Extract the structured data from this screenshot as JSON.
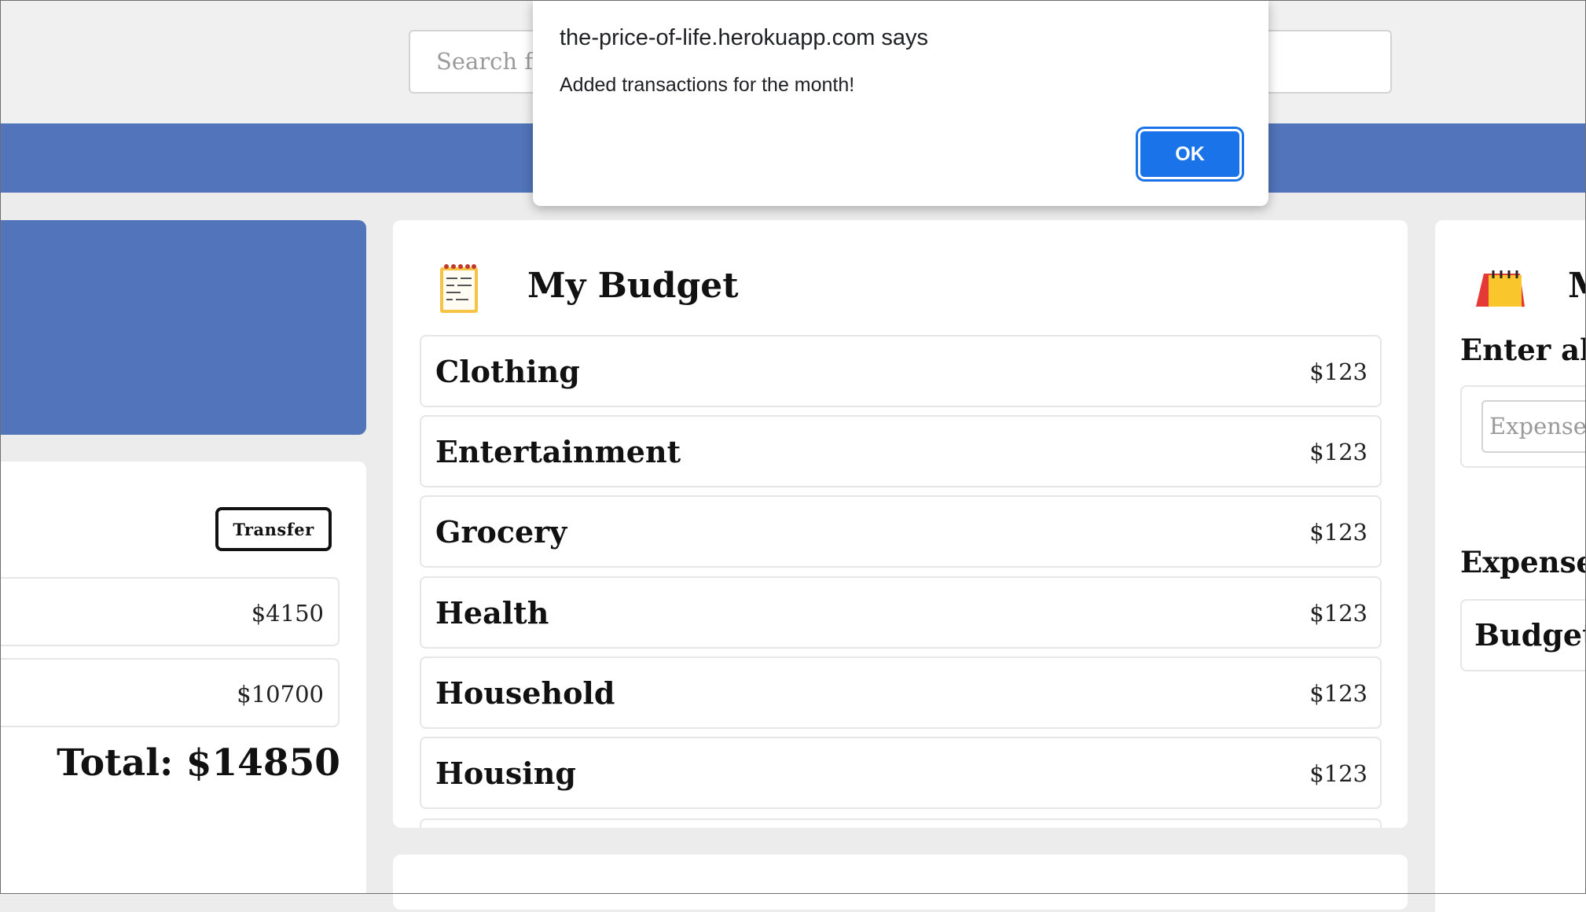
{
  "search": {
    "placeholder": "Search for"
  },
  "accounts": {
    "transfer_label": "Transfer",
    "items": [
      {
        "amount": "$4150"
      },
      {
        "amount": "$10700"
      }
    ],
    "total": "Total: $14850"
  },
  "budget": {
    "title": "My Budget",
    "icon": "notepad-icon",
    "items": [
      {
        "label": "Clothing",
        "amount": "$123"
      },
      {
        "label": "Entertainment",
        "amount": "$123"
      },
      {
        "label": "Grocery",
        "amount": "$123"
      },
      {
        "label": "Health",
        "amount": "$123"
      },
      {
        "label": "Household",
        "amount": "$123"
      },
      {
        "label": "Housing",
        "amount": "$123"
      }
    ]
  },
  "right_panel": {
    "icon": "calendar-icon",
    "title": "M",
    "enter_heading": "Enter all",
    "expense_placeholder": "Expense",
    "expenses_heading": "Expense",
    "budget_row_label": "Budget"
  },
  "dialog": {
    "title": "the-price-of-life.herokuapp.com says",
    "message": "Added transactions for the month!",
    "ok_label": "OK"
  },
  "colors": {
    "brand_blue": "#5174ba",
    "ok_blue": "#1a73e8",
    "background": "#ececec"
  }
}
